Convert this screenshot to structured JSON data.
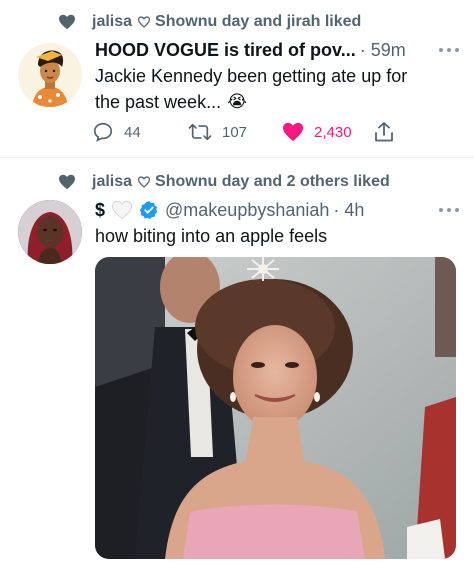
{
  "tweet1": {
    "social_user": "jalisa",
    "social_text": "Shownu day and jirah liked",
    "author_name": "HOOD VOGUE is tired of pov...",
    "time": "· 59m",
    "body_line1": "Jackie Kennedy been getting ate up for",
    "body_line2": "the past week...",
    "emoji": "😭",
    "replies": "44",
    "retweets": "107",
    "likes": "2,430"
  },
  "tweet2": {
    "social_user": "jalisa",
    "social_text": "Shownu day and 2 others liked",
    "name_symbol": "$",
    "handle": "@makeupbyshaniah",
    "time": "· 4h",
    "body": "how biting into an apple feels"
  },
  "colors": {
    "secondary_text": "#536471",
    "like_pink": "#f91880",
    "verified_blue": "#1d9bf0",
    "divider": "#eff3f4"
  },
  "icons": [
    "heart-icon",
    "heart-outline-icon",
    "more-icon",
    "reply-icon",
    "retweet-icon",
    "share-icon",
    "verified-icon",
    "white-heart-icon"
  ]
}
